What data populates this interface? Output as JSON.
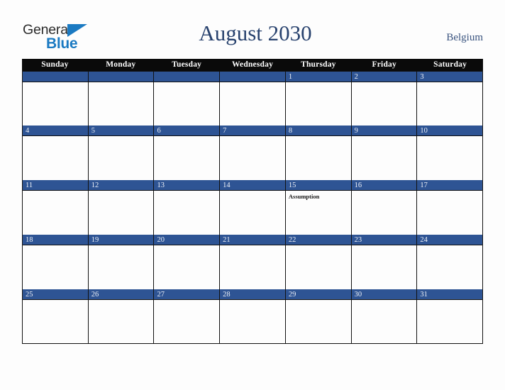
{
  "brand": {
    "name_part1": "General",
    "name_part2": "Blue",
    "mark_color": "#1b7ac2"
  },
  "header": {
    "title": "August 2030",
    "region": "Belgium"
  },
  "colors": {
    "page_background": "#fdfdfd",
    "header_row_background": "#0a0a0a",
    "date_band_background": "#2e5494",
    "date_number_text": "#eef1f7",
    "title_text": "#28426e",
    "region_text": "#3a547f",
    "grid_border": "#111111",
    "brand_blue": "#1b7ac2",
    "brand_dark": "#2b2b2b"
  },
  "calendar": {
    "month": "August",
    "year": "2030",
    "weekday_headers": [
      "Sunday",
      "Monday",
      "Tuesday",
      "Wednesday",
      "Thursday",
      "Friday",
      "Saturday"
    ],
    "weeks": [
      [
        {
          "date": "",
          "events": []
        },
        {
          "date": "",
          "events": []
        },
        {
          "date": "",
          "events": []
        },
        {
          "date": "",
          "events": []
        },
        {
          "date": "1",
          "events": []
        },
        {
          "date": "2",
          "events": []
        },
        {
          "date": "3",
          "events": []
        }
      ],
      [
        {
          "date": "4",
          "events": []
        },
        {
          "date": "5",
          "events": []
        },
        {
          "date": "6",
          "events": []
        },
        {
          "date": "7",
          "events": []
        },
        {
          "date": "8",
          "events": []
        },
        {
          "date": "9",
          "events": []
        },
        {
          "date": "10",
          "events": []
        }
      ],
      [
        {
          "date": "11",
          "events": []
        },
        {
          "date": "12",
          "events": []
        },
        {
          "date": "13",
          "events": []
        },
        {
          "date": "14",
          "events": []
        },
        {
          "date": "15",
          "events": [
            "Assumption"
          ]
        },
        {
          "date": "16",
          "events": []
        },
        {
          "date": "17",
          "events": []
        }
      ],
      [
        {
          "date": "18",
          "events": []
        },
        {
          "date": "19",
          "events": []
        },
        {
          "date": "20",
          "events": []
        },
        {
          "date": "21",
          "events": []
        },
        {
          "date": "22",
          "events": []
        },
        {
          "date": "23",
          "events": []
        },
        {
          "date": "24",
          "events": []
        }
      ],
      [
        {
          "date": "25",
          "events": []
        },
        {
          "date": "26",
          "events": []
        },
        {
          "date": "27",
          "events": []
        },
        {
          "date": "28",
          "events": []
        },
        {
          "date": "29",
          "events": []
        },
        {
          "date": "30",
          "events": []
        },
        {
          "date": "31",
          "events": []
        }
      ]
    ]
  }
}
